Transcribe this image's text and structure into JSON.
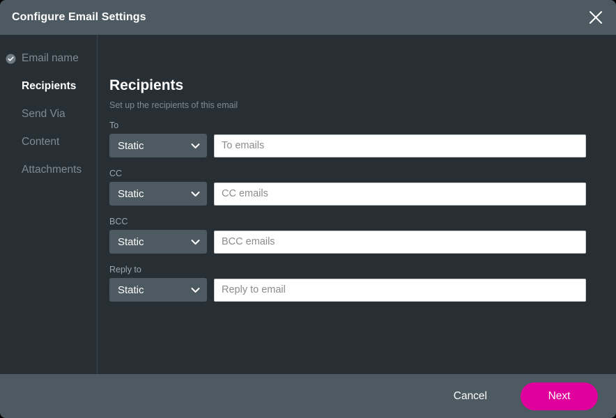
{
  "window": {
    "title": "Configure Email Settings",
    "close_icon": "close-icon"
  },
  "sidebar": {
    "items": [
      {
        "label": "Email name",
        "state": "done",
        "icon": "check-circle-icon"
      },
      {
        "label": "Recipients",
        "state": "active",
        "icon": ""
      },
      {
        "label": "Send Via",
        "state": "pending",
        "icon": ""
      },
      {
        "label": "Content",
        "state": "pending",
        "icon": ""
      },
      {
        "label": "Attachments",
        "state": "pending",
        "icon": ""
      }
    ]
  },
  "main": {
    "title": "Recipients",
    "subtitle": "Set up the recipients of this email",
    "fields": [
      {
        "label": "To",
        "select_value": "Static",
        "select_options": [
          "Static"
        ],
        "input_value": "",
        "input_placeholder": "To emails",
        "chevron_icon": "chevron-down-icon"
      },
      {
        "label": "CC",
        "select_value": "Static",
        "select_options": [
          "Static"
        ],
        "input_value": "",
        "input_placeholder": "CC emails",
        "chevron_icon": "chevron-down-icon"
      },
      {
        "label": "BCC",
        "select_value": "Static",
        "select_options": [
          "Static"
        ],
        "input_value": "",
        "input_placeholder": "BCC emails",
        "chevron_icon": "chevron-down-icon"
      },
      {
        "label": "Reply to",
        "select_value": "Static",
        "select_options": [
          "Static"
        ],
        "input_value": "",
        "input_placeholder": "Reply to email",
        "chevron_icon": "chevron-down-icon"
      }
    ]
  },
  "footer": {
    "cancel_label": "Cancel",
    "next_label": "Next"
  },
  "colors": {
    "dialog_background": "#272F35",
    "chrome_background": "#4D5A61",
    "accent": "#E0009B",
    "muted_text": "#7E8B91",
    "divider": "#3C464D",
    "input_background": "#FFFFFF"
  }
}
